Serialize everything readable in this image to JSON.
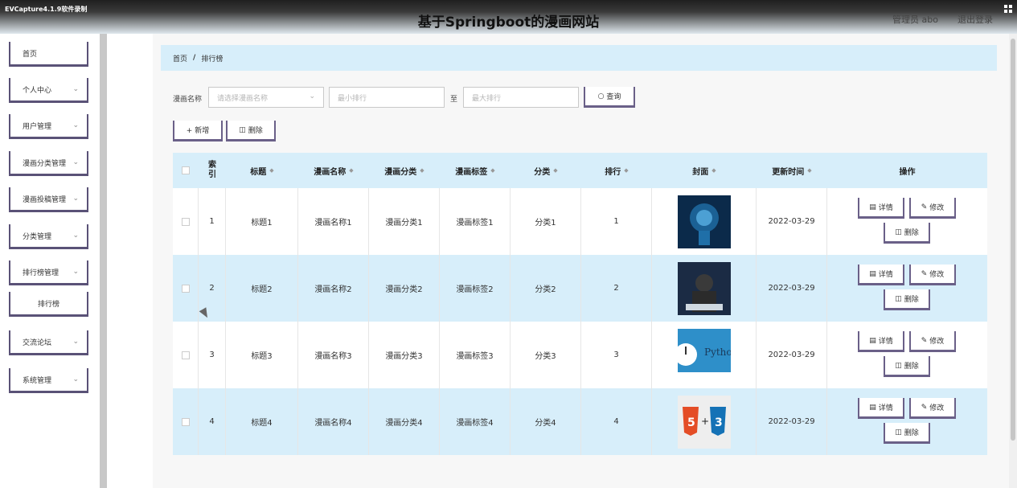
{
  "header": {
    "watermark": "EVCapture4.1.9软件录制",
    "title": "基于Springboot的漫画网站",
    "admin": "管理员 abo",
    "logout": "退出登录"
  },
  "sidebar": {
    "items": [
      {
        "label": "首页",
        "has_chevron": false
      },
      {
        "label": "个人中心",
        "has_chevron": true
      },
      {
        "label": "用户管理",
        "has_chevron": true
      },
      {
        "label": "漫画分类管理",
        "has_chevron": true
      },
      {
        "label": "漫画投稿管理",
        "has_chevron": true
      },
      {
        "label": "分类管理",
        "has_chevron": true
      },
      {
        "label": "排行榜管理",
        "has_chevron": true
      },
      {
        "label": "排行榜",
        "has_chevron": false
      },
      {
        "label": "交流论坛",
        "has_chevron": true
      },
      {
        "label": "系统管理",
        "has_chevron": true
      }
    ]
  },
  "breadcrumb": {
    "home": "首页",
    "separator": "/",
    "current": "排行榜"
  },
  "search": {
    "label": "漫画名称",
    "name_placeholder": "请选择漫画名称",
    "min_placeholder": "最小排行",
    "to_label": "至",
    "max_placeholder": "最大排行",
    "query_label": "查询"
  },
  "actions": {
    "add_label": "+ 新增",
    "delete_label": "删除"
  },
  "table": {
    "columns": [
      "索引",
      "标题",
      "漫画名称",
      "漫画分类",
      "漫画标签",
      "分类",
      "排行",
      "封面",
      "更新时间",
      "操作"
    ],
    "rows": [
      {
        "index": "1",
        "title": "标题1",
        "name": "漫画名称1",
        "category": "漫画分类1",
        "tag": "漫画标签1",
        "class": "分类1",
        "rank": "1",
        "cover": "ai-head",
        "updated": "2022-03-29"
      },
      {
        "index": "2",
        "title": "标题2",
        "name": "漫画名称2",
        "category": "漫画分类2",
        "tag": "漫画标签2",
        "class": "分类2",
        "rank": "2",
        "cover": "hacker",
        "updated": "2022-03-29"
      },
      {
        "index": "3",
        "title": "标题3",
        "name": "漫画名称3",
        "category": "漫画分类3",
        "tag": "漫画标签3",
        "class": "分类3",
        "rank": "3",
        "cover": "python",
        "updated": "2022-03-29"
      },
      {
        "index": "4",
        "title": "标题4",
        "name": "漫画名称4",
        "category": "漫画分类4",
        "tag": "漫画标签4",
        "class": "分类4",
        "rank": "4",
        "cover": "html5-css3",
        "updated": "2022-03-29"
      }
    ],
    "op_detail": "详情",
    "op_edit": "修改",
    "op_delete": "删除"
  },
  "cover_text": {
    "python": "Python"
  },
  "colors": {
    "accent_border": "#6a6088",
    "row_highlight": "#d7eefa",
    "header_dark": "#1f1f1f"
  }
}
